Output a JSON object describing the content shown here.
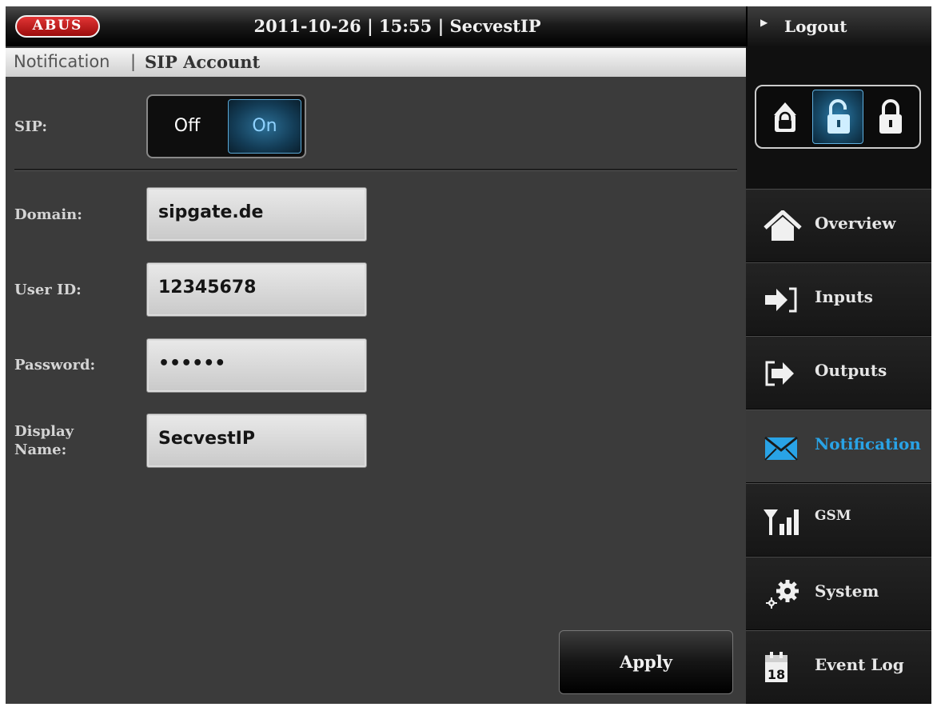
{
  "header": {
    "logo": "ABUS",
    "datetime": "2011-10-26  |  15:55  |  SecvestIP",
    "logout_label": "Logout"
  },
  "breadcrumb": {
    "parent": "Notification",
    "separator": "|",
    "current": "SIP Account"
  },
  "form": {
    "sip_label": "SIP:",
    "sip_toggle": {
      "off_label": "Off",
      "on_label": "On",
      "selected": "On"
    },
    "fields": [
      {
        "label": "Domain:",
        "value": "sipgate.de"
      },
      {
        "label": "User ID:",
        "value": "12345678"
      },
      {
        "label": "Password:",
        "value": "••••••"
      },
      {
        "label_line1": "Display",
        "label_line2": "Name:",
        "value": "SecvestIP"
      }
    ],
    "apply_label": "Apply"
  },
  "sidebar": {
    "lock_states": [
      "lock-closed-icon",
      "lock-open-icon",
      "lock-closed-icon"
    ],
    "active_lock_index": 1,
    "items": [
      {
        "label": "Overview",
        "icon": "home-icon"
      },
      {
        "label": "Inputs",
        "icon": "input-arrow-icon"
      },
      {
        "label": "Outputs",
        "icon": "output-arrow-icon"
      },
      {
        "label": "Notification",
        "icon": "envelope-icon"
      },
      {
        "label": "GSM",
        "icon": "signal-icon"
      },
      {
        "label": "System",
        "icon": "gears-icon"
      },
      {
        "label": "Event Log",
        "icon": "calendar-icon",
        "icon_text": "18"
      }
    ],
    "active_item": "Notification"
  },
  "colors": {
    "background": "#3b3b3b",
    "accent_blue": "#29a3e6",
    "logo_red": "#c01818"
  }
}
